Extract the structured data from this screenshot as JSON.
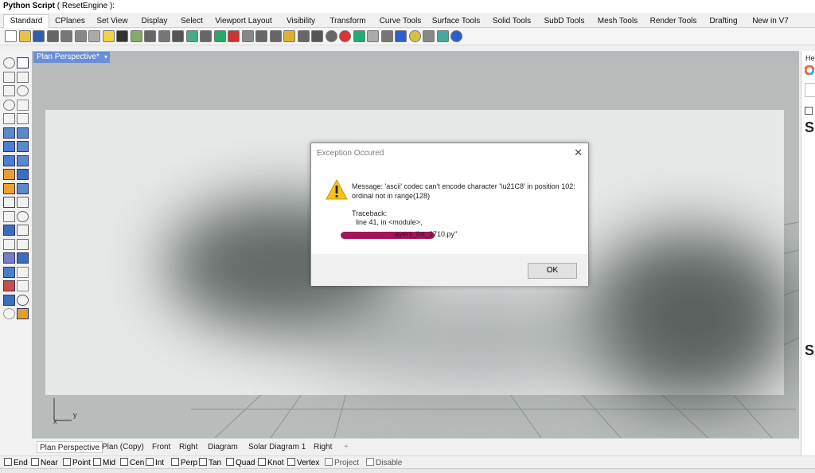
{
  "command": {
    "name": "Python Script",
    "args": "( ResetEngine ):"
  },
  "tabs": [
    "Standard",
    "CPlanes",
    "Set View",
    "Display",
    "Select",
    "Viewport Layout",
    "Visibility",
    "Transform",
    "Curve Tools",
    "Surface Tools",
    "Solid Tools",
    "SubD Tools",
    "Mesh Tools",
    "Render Tools",
    "Drafting",
    "New in V7"
  ],
  "active_tab": "Standard",
  "viewport": {
    "title": "Plan Perspective*",
    "dropdown": "▾",
    "axis_x": "x",
    "axis_y": "y"
  },
  "dialog": {
    "title": "Exception Occured",
    "close": "✕",
    "message_line1": "Message: 'ascii' codec can't encode character '\\u21C8' in position 102:",
    "message_line2": "ordinal not in range(128)",
    "traceback_label": "Traceback:",
    "traceback_line": "line 41, in <module>,",
    "file_fragment": "ayers_list_2710.py\"",
    "ok": "OK"
  },
  "viewport_tabs": [
    "Plan Perspective",
    "Plan (Copy)",
    "Front",
    "Right",
    "Diagram",
    "Solar Diagram 1",
    "Right"
  ],
  "add_tab": "+",
  "osnaps": [
    {
      "label": "End",
      "checked": false,
      "enabled": true
    },
    {
      "label": "Near",
      "checked": false,
      "enabled": true
    },
    {
      "label": "Point",
      "checked": false,
      "enabled": true
    },
    {
      "label": "Mid",
      "checked": false,
      "enabled": true
    },
    {
      "label": "Cen",
      "checked": false,
      "enabled": true
    },
    {
      "label": "Int",
      "checked": false,
      "enabled": true
    },
    {
      "label": "Perp",
      "checked": false,
      "enabled": true
    },
    {
      "label": "Tan",
      "checked": false,
      "enabled": true
    },
    {
      "label": "Quad",
      "checked": false,
      "enabled": true
    },
    {
      "label": "Knot",
      "checked": false,
      "enabled": true
    },
    {
      "label": "Vertex",
      "checked": false,
      "enabled": true
    },
    {
      "label": "Project",
      "checked": false,
      "enabled": false
    },
    {
      "label": "Disable",
      "checked": false,
      "enabled": false
    }
  ],
  "right_panel": {
    "header": "He",
    "heading1": "S",
    "heading2": "S"
  },
  "colors": {
    "viewport_title_bg": "#6b8fd6",
    "redaction": "#a3155a",
    "warning": "#f5c518"
  }
}
